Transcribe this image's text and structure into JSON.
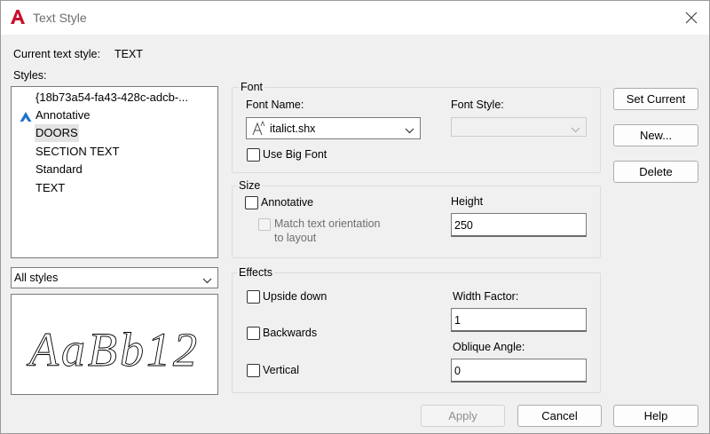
{
  "window": {
    "title": "Text Style",
    "app_icon": "autocad-a-icon",
    "close_icon": "close-icon"
  },
  "current_style": {
    "label": "Current text style:",
    "value": "TEXT"
  },
  "styles": {
    "label": "Styles:",
    "items": [
      {
        "label": "{18b73a54-fa43-428c-adcb-...",
        "annotative": false,
        "selected": false
      },
      {
        "label": "Annotative",
        "annotative": true,
        "selected": false
      },
      {
        "label": "DOORS",
        "annotative": false,
        "selected": true
      },
      {
        "label": "SECTION TEXT",
        "annotative": false,
        "selected": false
      },
      {
        "label": "Standard",
        "annotative": false,
        "selected": false
      },
      {
        "label": "TEXT",
        "annotative": false,
        "selected": false
      }
    ],
    "filter_value": "All styles"
  },
  "preview": {
    "text": "AaBb12"
  },
  "font": {
    "group_label": "Font",
    "font_name_label": "Font Name:",
    "font_name_value": "italict.shx",
    "font_style_label": "Font Style:",
    "font_style_value": "",
    "use_big_font_label": "Use Big Font",
    "use_big_font_checked": false
  },
  "size": {
    "group_label": "Size",
    "annotative_label": "Annotative",
    "annotative_checked": false,
    "match_orientation_line1": "Match text orientation",
    "match_orientation_line2": "to layout",
    "height_label": "Height",
    "height_value": "250"
  },
  "effects": {
    "group_label": "Effects",
    "upside_down_label": "Upside down",
    "backwards_label": "Backwards",
    "vertical_label": "Vertical",
    "width_factor_label": "Width Factor:",
    "width_factor_value": "1",
    "oblique_angle_label": "Oblique Angle:",
    "oblique_angle_value": "0"
  },
  "buttons": {
    "set_current": "Set Current",
    "new": "New...",
    "delete": "Delete",
    "apply": "Apply",
    "cancel": "Cancel",
    "help": "Help"
  },
  "colors": {
    "accent_red": "#c8102e",
    "annotative_blue": "#1e73c8",
    "list_selection": "#e3e3e3"
  }
}
